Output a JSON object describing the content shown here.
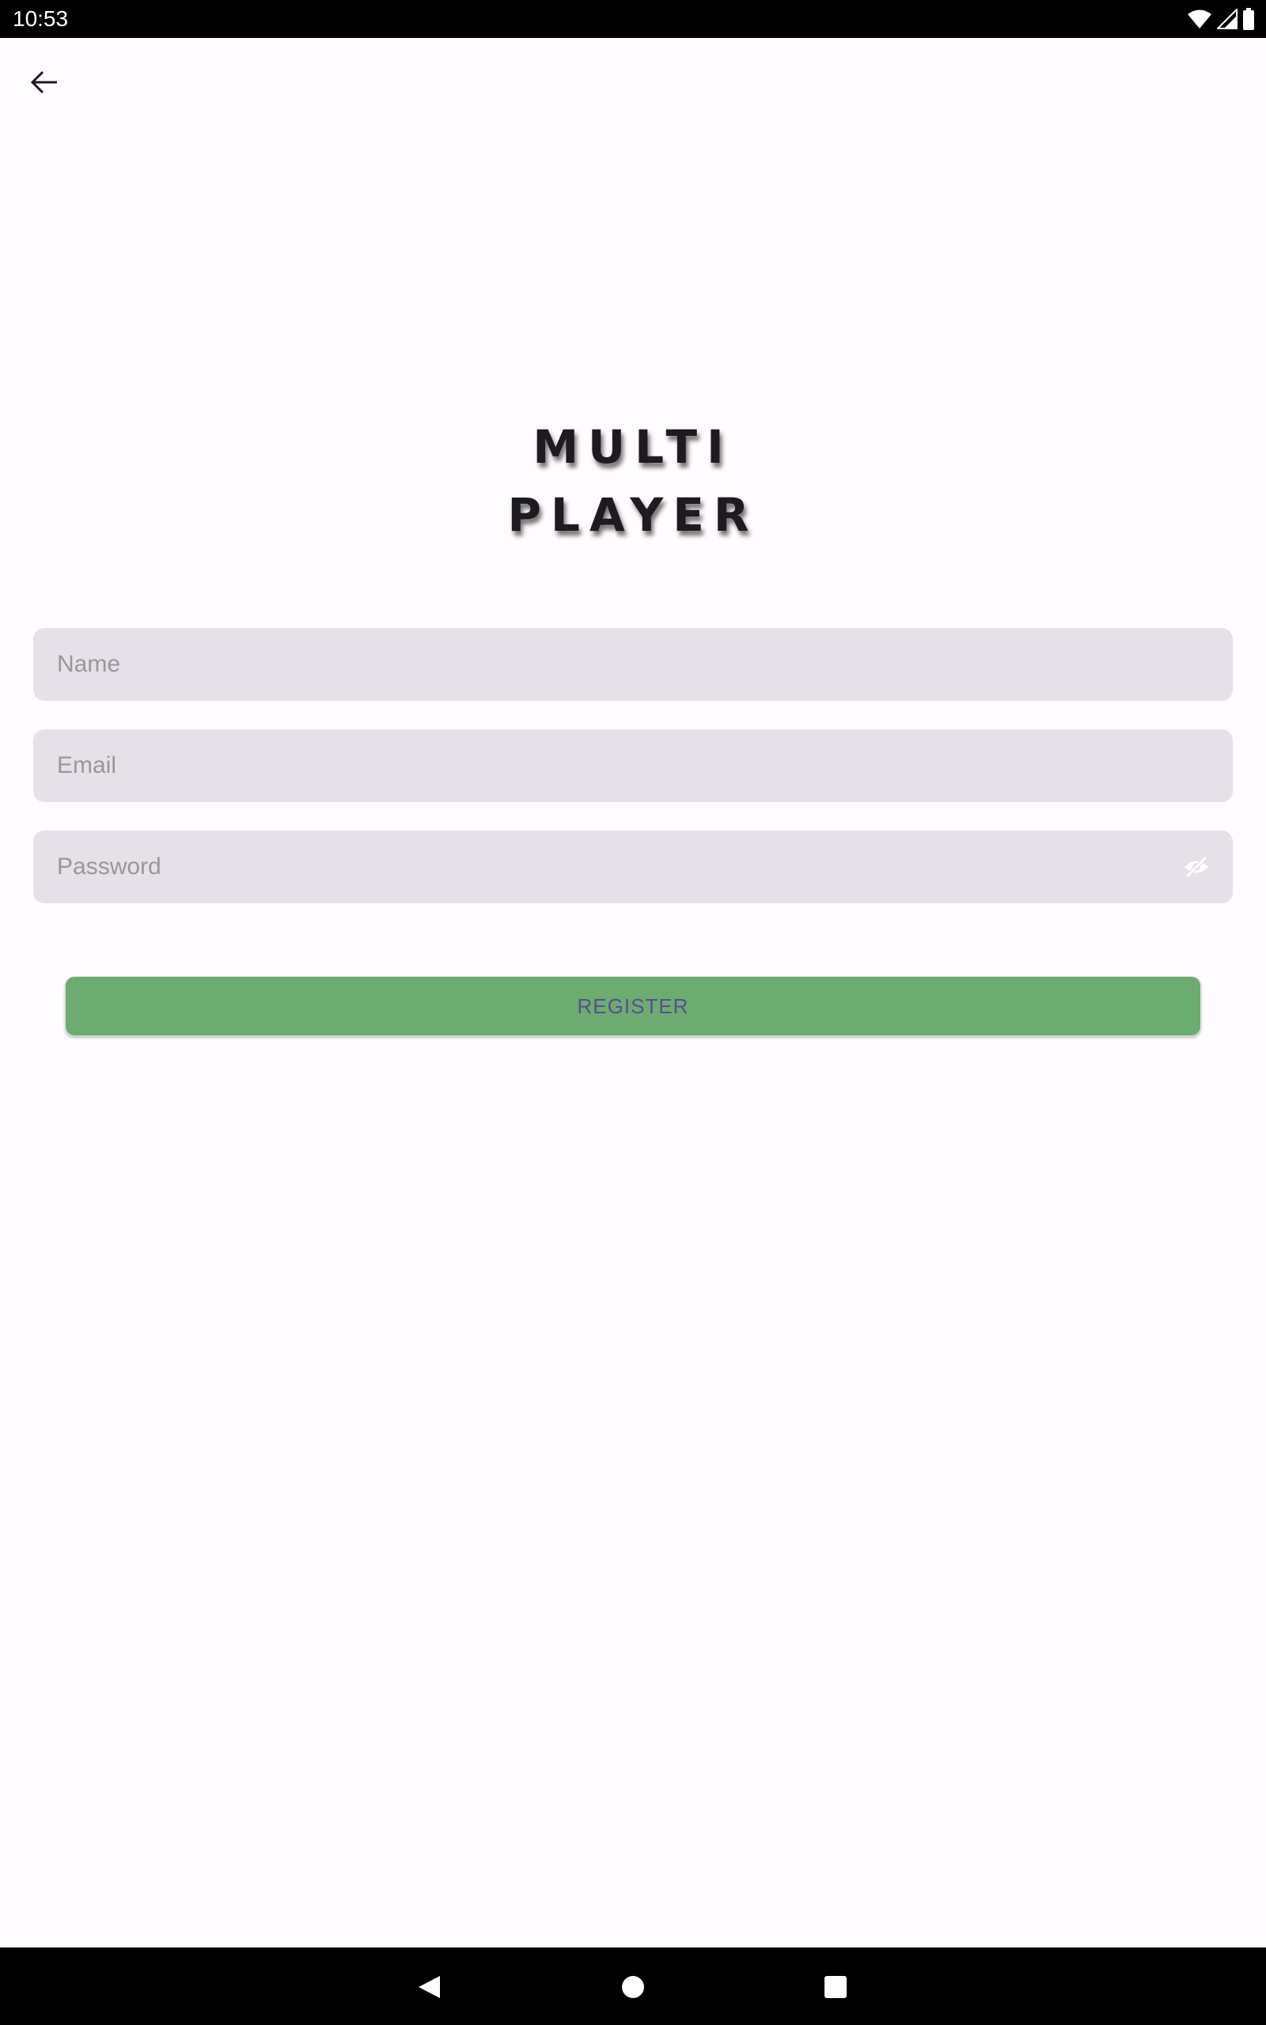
{
  "status_bar": {
    "time": "10:53",
    "icons": [
      "wifi-icon",
      "cell-signal-icon",
      "battery-icon"
    ]
  },
  "header": {
    "back_icon": "arrow-left-icon"
  },
  "title": {
    "line1": "MULTI",
    "line2": "PLAYER"
  },
  "form": {
    "name_placeholder": "Name",
    "name_value": "",
    "email_placeholder": "Email",
    "email_value": "",
    "password_placeholder": "Password",
    "password_value": "",
    "password_toggle_icon": "eye-off-icon"
  },
  "register_button": {
    "label": "REGISTER"
  },
  "nav_bar": {
    "icons": [
      "nav-back-icon",
      "nav-home-icon",
      "nav-recents-icon"
    ]
  },
  "colors": {
    "background": "#fffbfe",
    "field_background": "#e6e0e9",
    "button_background": "#6cac71",
    "button_text": "#5b4c96",
    "system_bars": "#000000"
  }
}
